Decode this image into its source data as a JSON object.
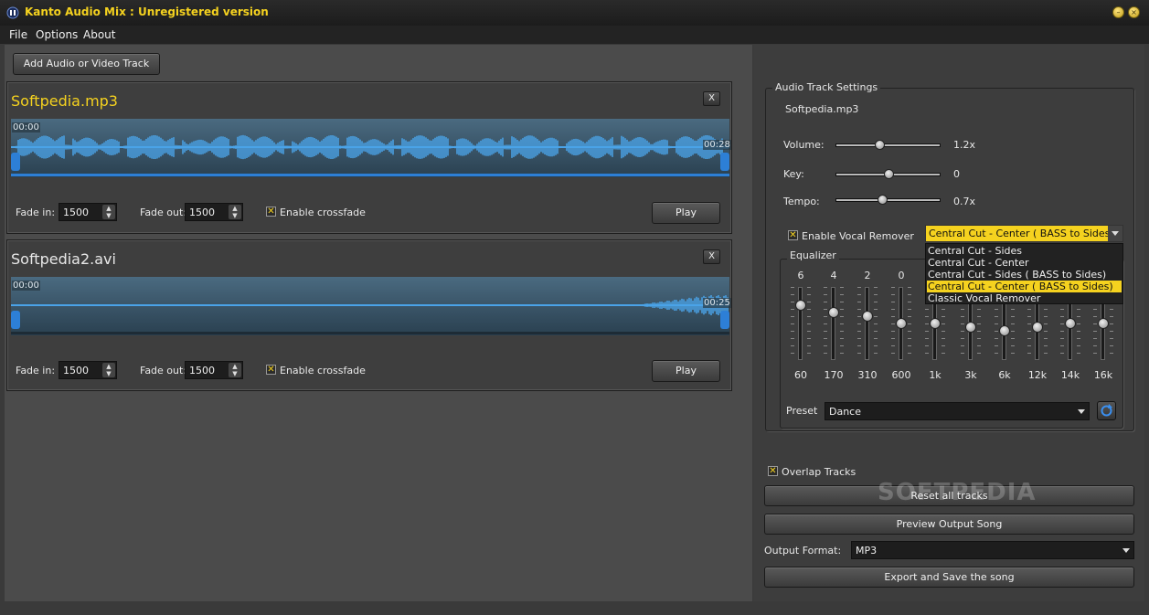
{
  "window": {
    "title": "Kanto Audio Mix : Unregistered version",
    "minimize_glyph": "–",
    "close_glyph": "×"
  },
  "menu": {
    "items": [
      "File",
      "Options",
      "About"
    ]
  },
  "toolbar": {
    "add_track_label": "Add Audio or Video Track"
  },
  "tracks": [
    {
      "name": "Softpedia.mp3",
      "close_label": "X",
      "start_time": "00:00",
      "end_time": "00:28",
      "fade_in_label": "Fade in:",
      "fade_in_value": "1500",
      "fade_out_label": "Fade out:",
      "fade_out_value": "1500",
      "crossfade_label": "Enable crossfade",
      "crossfade_checked": true,
      "play_label": "Play"
    },
    {
      "name": "Softpedia2.avi",
      "close_label": "X",
      "start_time": "00:00",
      "end_time": "00:25",
      "fade_in_label": "Fade in:",
      "fade_in_value": "1500",
      "fade_out_label": "Fade out:",
      "fade_out_value": "1500",
      "crossfade_label": "Enable crossfade",
      "crossfade_checked": true,
      "play_label": "Play"
    }
  ],
  "settings": {
    "group_title": "Audio Track Settings",
    "file_name": "Softpedia.mp3",
    "volume": {
      "label": "Volume:",
      "value": "1.2x",
      "level": 0.42
    },
    "key": {
      "label": "Key:",
      "value": "0",
      "level": 0.5
    },
    "tempo": {
      "label": "Tempo:",
      "value": "0.7x",
      "level": 0.44
    },
    "vocal_remover_label": "Enable Vocal Remover",
    "vocal_remover_checked": true,
    "vocal_mode_selected": "Central Cut - Center ( BASS to Sides)",
    "vocal_mode_options": [
      "Central Cut - Sides",
      "Central Cut - Center",
      "Central Cut - Sides ( BASS to Sides)",
      "Central Cut - Center ( BASS to Sides)",
      "Classic Vocal Remover"
    ],
    "highlighted_option_index": 3
  },
  "equalizer": {
    "title": "Equalizer",
    "bands": [
      {
        "freq": "60",
        "value": "6",
        "level": 0.75
      },
      {
        "freq": "170",
        "value": "4",
        "level": 0.65
      },
      {
        "freq": "310",
        "value": "2",
        "level": 0.6
      },
      {
        "freq": "600",
        "value": "0",
        "level": 0.5
      },
      {
        "freq": "1k",
        "value": "",
        "level": 0.5
      },
      {
        "freq": "3k",
        "value": "",
        "level": 0.45
      },
      {
        "freq": "6k",
        "value": "",
        "level": 0.4
      },
      {
        "freq": "12k",
        "value": "",
        "level": 0.45
      },
      {
        "freq": "14k",
        "value": "",
        "level": 0.5
      },
      {
        "freq": "16k",
        "value": "",
        "level": 0.5
      }
    ],
    "preset_label": "Preset",
    "preset_value": "Dance"
  },
  "output": {
    "overlap_label": "Overlap Tracks",
    "overlap_checked": true,
    "reset_label": "Reset all tracks",
    "preview_label": "Preview Output Song",
    "format_label": "Output Format:",
    "format_value": "MP3",
    "export_label": "Export and Save the song"
  },
  "watermark": "SOFTPEDIA",
  "colors": {
    "accent": "#f5d21f",
    "waveform": "#4aa3e8",
    "handle": "#2d7fd6",
    "highlight": "#f5d21f"
  }
}
